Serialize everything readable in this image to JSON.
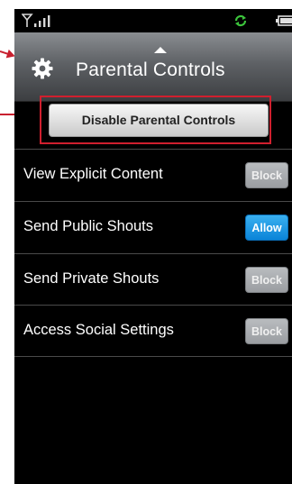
{
  "header": {
    "title": "Parental Controls"
  },
  "primary_action": {
    "label": "Disable Parental Controls"
  },
  "settings": [
    {
      "label": "View Explicit Content",
      "state": "Block"
    },
    {
      "label": "Send Public Shouts",
      "state": "Allow"
    },
    {
      "label": "Send Private Shouts",
      "state": "Block"
    },
    {
      "label": "Access Social Settings",
      "state": "Block"
    }
  ],
  "icons": {
    "status": [
      "signal-icon",
      "sync-icon",
      "battery-icon"
    ],
    "header": "gear-icon"
  },
  "colors": {
    "callout": "#c8202f",
    "allow_toggle": "#0a84d8",
    "block_toggle": "#9a9da1",
    "sync": "#3cc43c"
  }
}
